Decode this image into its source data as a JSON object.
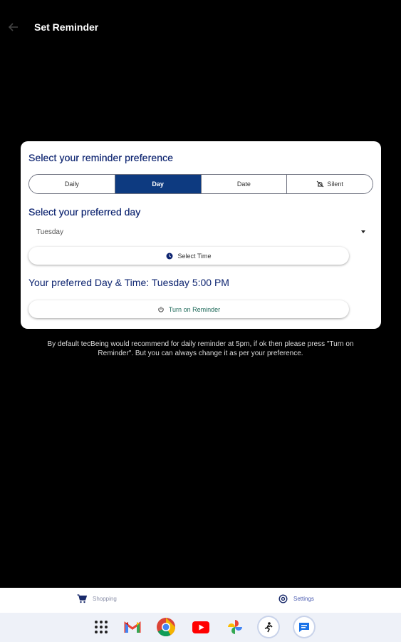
{
  "header": {
    "title": "Set Reminder",
    "back_icon": "arrow-left-icon"
  },
  "card": {
    "heading": "Select your reminder preference",
    "segments": [
      {
        "label": "Daily",
        "active": false
      },
      {
        "label": "Day",
        "active": true
      },
      {
        "label": "Date",
        "active": false
      },
      {
        "label": "Silent",
        "active": false,
        "icon": "bell-off-icon"
      }
    ],
    "day_heading": "Select your preferred day",
    "selected_day": "Tuesday",
    "select_time_label": "Select Time",
    "preference_text": "Your preferred Day & Time: Tuesday 5:00 PM",
    "turn_on_label": "Turn on Reminder"
  },
  "note": "By default tecBeing would recommend for daily reminder at 5pm, if ok then please press \"Turn on Reminder\". But you can always change it as per your preference.",
  "bottom_nav": {
    "shopping_label": "Shopping",
    "settings_label": "Settings"
  },
  "dock": {
    "apps": [
      "apps-grid-icon",
      "gmail-icon",
      "chrome-icon",
      "youtube-icon",
      "photos-icon",
      "tecbeing-icon",
      "messages-icon"
    ]
  },
  "colors": {
    "accent": "#0d3a80",
    "heading": "#0d2470",
    "background": "#000000"
  }
}
